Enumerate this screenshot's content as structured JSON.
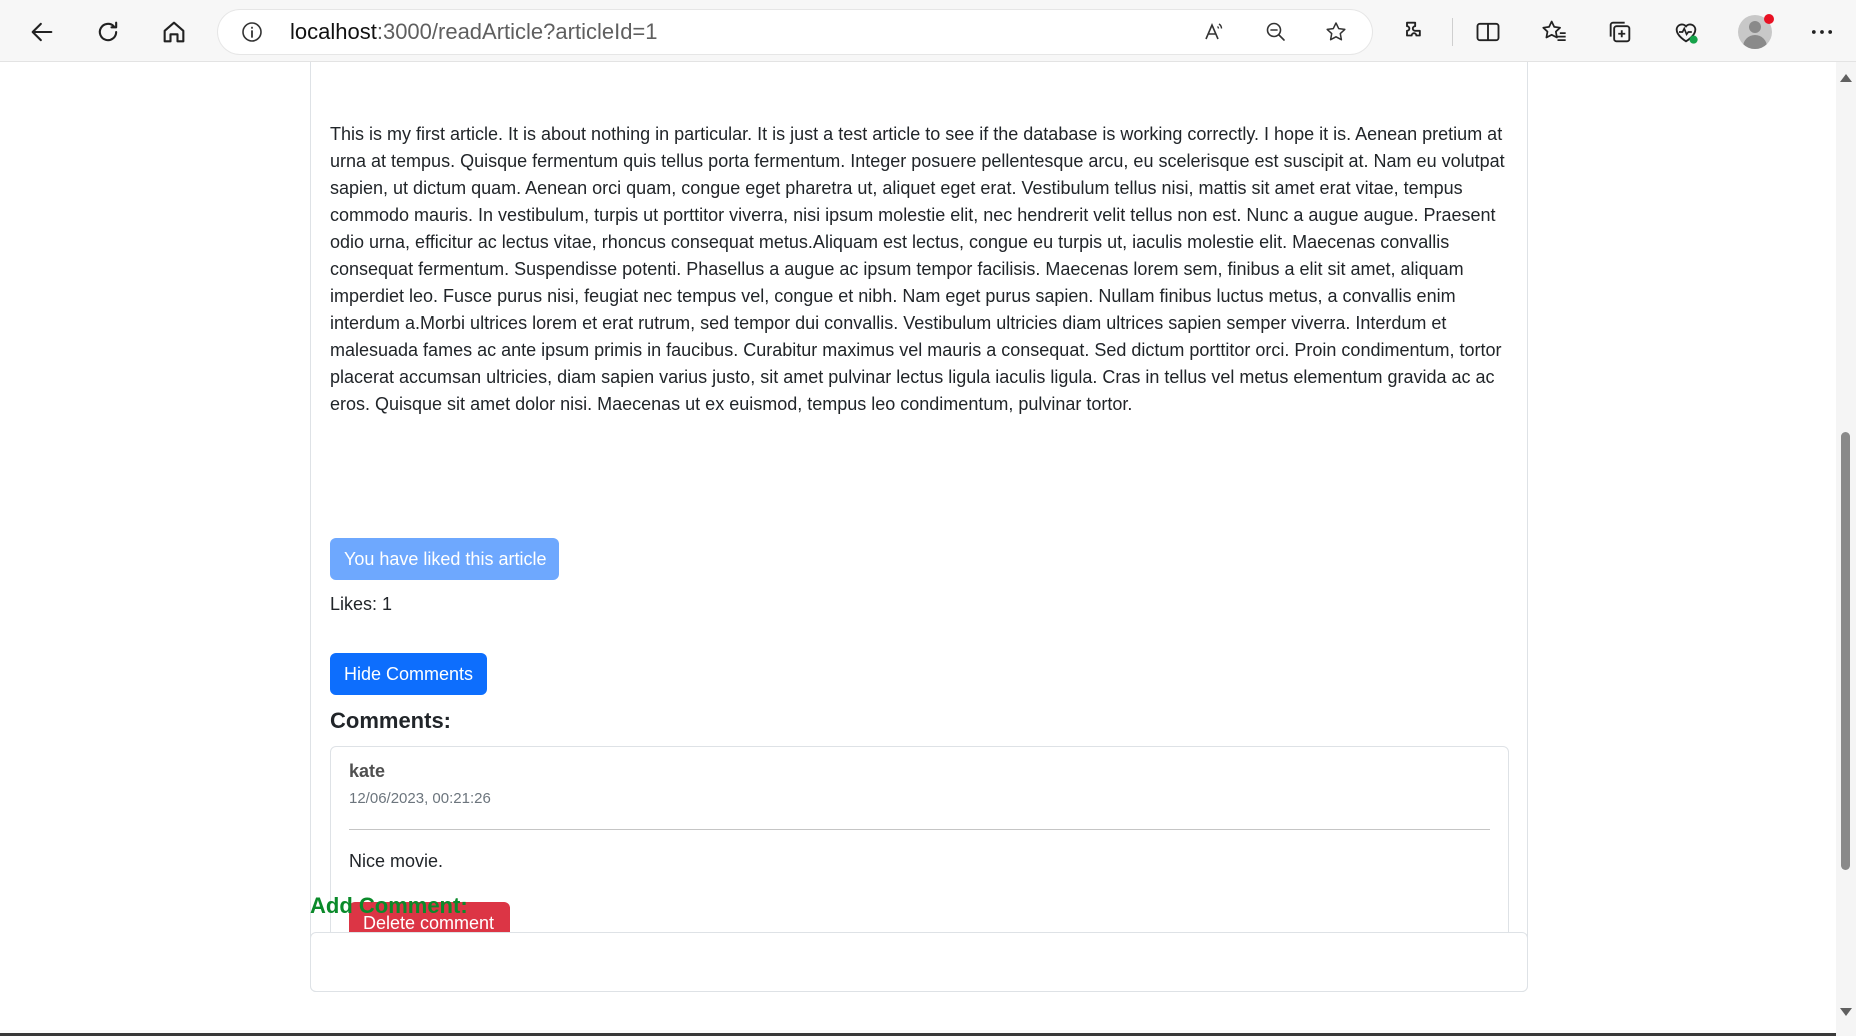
{
  "browser": {
    "url_host": "localhost",
    "url_path": ":3000/readArticle?articleId=1",
    "icons": [
      "back-icon",
      "refresh-icon",
      "home-icon",
      "info-icon",
      "read-aloud-icon",
      "zoom-out-icon",
      "favorite-star-icon",
      "extensions-icon",
      "split-screen-icon",
      "favorites-icon",
      "collections-icon",
      "browser-essentials-icon",
      "profile-avatar-icon",
      "more-menu-icon"
    ]
  },
  "article": {
    "body": "This is my first article. It is about nothing in particular. It is just a test article to see if the database is working correctly. I hope it is. Aenean pretium at urna at tempus. Quisque fermentum quis tellus porta fermentum. Integer posuere pellentesque arcu, eu scelerisque est suscipit at. Nam eu volutpat sapien, ut dictum quam. Aenean orci quam, congue eget pharetra ut, aliquet eget erat. Vestibulum tellus nisi, mattis sit amet erat vitae, tempus commodo mauris. In vestibulum, turpis ut porttitor viverra, nisi ipsum molestie elit, nec hendrerit velit tellus non est. Nunc a augue augue. Praesent odio urna, efficitur ac lectus vitae, rhoncus consequat metus.Aliquam est lectus, congue eu turpis ut, iaculis molestie elit. Maecenas convallis consequat fermentum. Suspendisse potenti. Phasellus a augue ac ipsum tempor facilisis. Maecenas lorem sem, finibus a elit sit amet, aliquam imperdiet leo. Fusce purus nisi, feugiat nec tempus vel, congue et nibh. Nam eget purus sapien. Nullam finibus luctus metus, a convallis enim interdum a.Morbi ultrices lorem et erat rutrum, sed tempor dui convallis. Vestibulum ultricies diam ultrices sapien semper viverra. Interdum et malesuada fames ac ante ipsum primis in faucibus. Curabitur maximus vel mauris a consequat. Sed dictum porttitor orci. Proin condimentum, tortor placerat accumsan ultricies, diam sapien varius justo, sit amet pulvinar lectus ligula iaculis ligula. Cras in tellus vel metus elementum gravida ac ac eros. Quisque sit amet dolor nisi. Maecenas ut ex euismod, tempus leo condimentum, pulvinar tortor.",
    "liked_button_label": "You have liked this article",
    "likes_text": "Likes: 1",
    "hide_comments_label": "Hide Comments",
    "comments_heading": "Comments:",
    "comments": [
      {
        "author": "kate",
        "date": "12/06/2023, 00:21:26",
        "text": "Nice movie.",
        "delete_label": "Delete comment"
      }
    ],
    "add_comment_heading": "Add Comment:"
  },
  "colors": {
    "primary": "#0d6efd",
    "primary_disabled": "#6ea8fe",
    "danger": "#dc3545",
    "success_heading": "#0a8a2a"
  }
}
